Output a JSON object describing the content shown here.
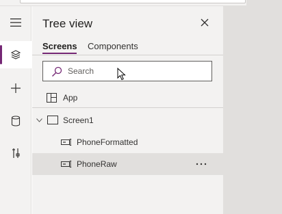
{
  "panel": {
    "title": "Tree view",
    "tabs": [
      {
        "label": "Screens",
        "active": true
      },
      {
        "label": "Components",
        "active": false
      }
    ],
    "search": {
      "placeholder": "Search",
      "value": ""
    },
    "items": [
      {
        "label": "App",
        "icon": "app-icon",
        "level": 0
      },
      {
        "label": "Screen1",
        "icon": "screen-icon",
        "level": 0,
        "expanded": true
      },
      {
        "label": "PhoneFormatted",
        "icon": "text-input-icon",
        "level": 1
      },
      {
        "label": "PhoneRaw",
        "icon": "text-input-icon",
        "level": 1,
        "selected": true
      }
    ],
    "more_label": "···"
  },
  "rail": {
    "items": [
      "hamburger-menu-icon",
      "layers-icon",
      "plus-icon",
      "database-icon",
      "tools-icon"
    ],
    "active": "layers-icon"
  },
  "colors": {
    "accent": "#742774",
    "rail_bg": "#f3f2f1",
    "panel_bg": "#f3f2f1",
    "selected_row": "#e1dfdd",
    "canvas_bg": "#e1dfdd"
  }
}
